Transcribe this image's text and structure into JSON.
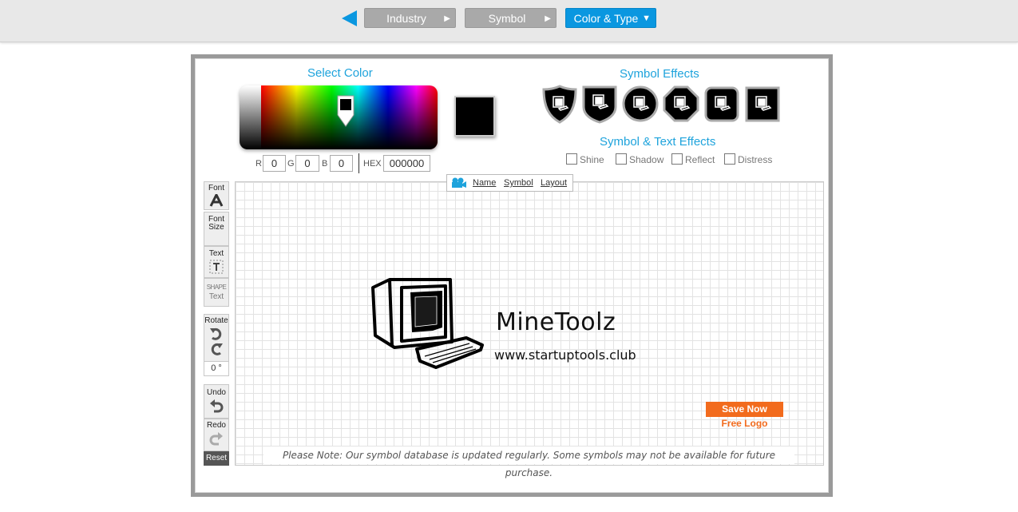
{
  "nav": {
    "steps": [
      {
        "label": "Industry",
        "state": "done"
      },
      {
        "label": "Symbol",
        "state": "done"
      },
      {
        "label": "Color & Type",
        "state": "active"
      }
    ],
    "accent_color": "#0a97e0"
  },
  "color_panel": {
    "title": "Select Color",
    "selected_color": "#000000",
    "r_label": "R",
    "r_value": "0",
    "g_label": "G",
    "g_value": "0",
    "b_label": "B",
    "b_value": "0",
    "hex_label": "HEX",
    "hex_value": "000000"
  },
  "symbol_effects": {
    "title": "Symbol Effects",
    "options": [
      "badge-effect-1",
      "badge-effect-2",
      "circle-effect-3",
      "octagon-effect-4",
      "rounded-square-effect-5",
      "square-effect-6"
    ]
  },
  "text_effects": {
    "title": "Symbol & Text Effects",
    "options": [
      {
        "label": "Shine",
        "checked": false
      },
      {
        "label": "Shadow",
        "checked": false
      },
      {
        "label": "Reflect",
        "checked": false
      },
      {
        "label": "Distress",
        "checked": false
      }
    ]
  },
  "canvas_tabs": [
    "Name",
    "Symbol",
    "Layout"
  ],
  "tools": {
    "font": "Font",
    "font_size_1": "Font",
    "font_size_2": "Size",
    "text": "Text",
    "shape_text_1": "SHAPE",
    "shape_text_2": "Text",
    "rotate": "Rotate",
    "rotation_value": "0 °",
    "undo": "Undo",
    "redo": "Redo",
    "reset": "Reset"
  },
  "logo": {
    "name": "MineToolz",
    "tagline": "www.startuptools.club",
    "symbol": "computer-icon"
  },
  "actions": {
    "save_now": "Save Now",
    "free_logo": "Free Logo"
  },
  "note": "Please Note: Our symbol database is updated regularly. Some symbols may not be available for future purchase."
}
